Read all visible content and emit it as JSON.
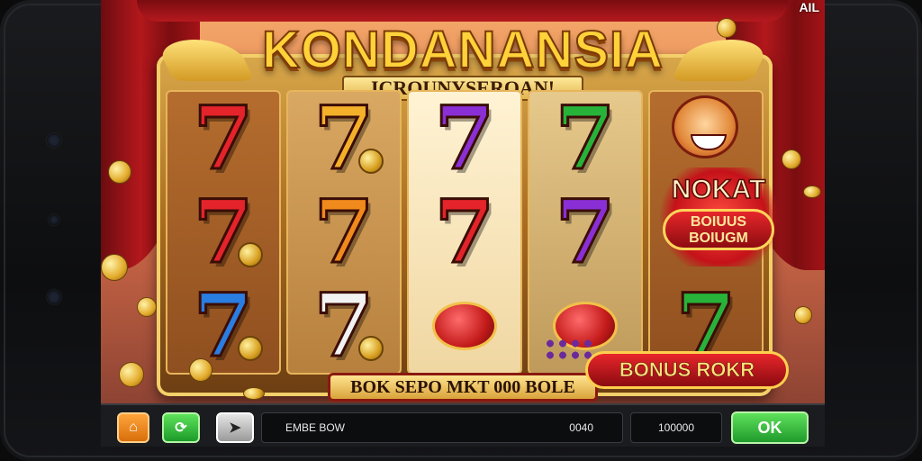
{
  "status": {
    "text": "AIL"
  },
  "game": {
    "title": "KONDANANSIA",
    "subtitle": "ICROUNYSEROAN!",
    "bonus_badge": {
      "top": "NOKAT",
      "line1": "BOIUUS",
      "line2": "BOIUGM"
    },
    "ticker": "BOK SEPO MKT 000 BOLE",
    "bonus_button": "BONUS ROKR",
    "colors": {
      "title": "#ffd23a",
      "red": "#e4242a",
      "orange": "#f08a1c",
      "purple": "#8a2fd6",
      "green": "#27b33a",
      "blue": "#2a7de1",
      "white": "#f2f2f2",
      "gold": "#e7a826"
    },
    "reels": [
      [
        {
          "type": "seven",
          "color": "#e4242a"
        },
        {
          "type": "seven",
          "color": "#e4242a",
          "coin": true
        },
        {
          "type": "seven",
          "color": "#2a7de1",
          "coin": true
        }
      ],
      [
        {
          "type": "seven",
          "color": "#f5b02a",
          "coin": true
        },
        {
          "type": "seven",
          "color": "#f08a1c"
        },
        {
          "type": "seven",
          "color": "#f2f2f2",
          "coin": true
        }
      ],
      [
        {
          "type": "seven",
          "color": "#8a2fd6"
        },
        {
          "type": "seven",
          "color": "#e4242a"
        },
        {
          "type": "bell"
        }
      ],
      [
        {
          "type": "seven",
          "color": "#27b33a"
        },
        {
          "type": "seven",
          "color": "#8a2fd6"
        },
        {
          "type": "bell",
          "grapes": true
        }
      ],
      [
        {
          "type": "none"
        },
        {
          "type": "none"
        },
        {
          "type": "seven",
          "color": "#27b33a"
        }
      ]
    ]
  },
  "controls": {
    "btn_home_icon": "home-icon",
    "btn_refresh_icon": "refresh-icon",
    "btn_arrow_icon": "arrow-right-icon",
    "field_label": "EMBE BOW",
    "field_value": "0040",
    "credit_value": "100000",
    "ok_label": "OK"
  }
}
